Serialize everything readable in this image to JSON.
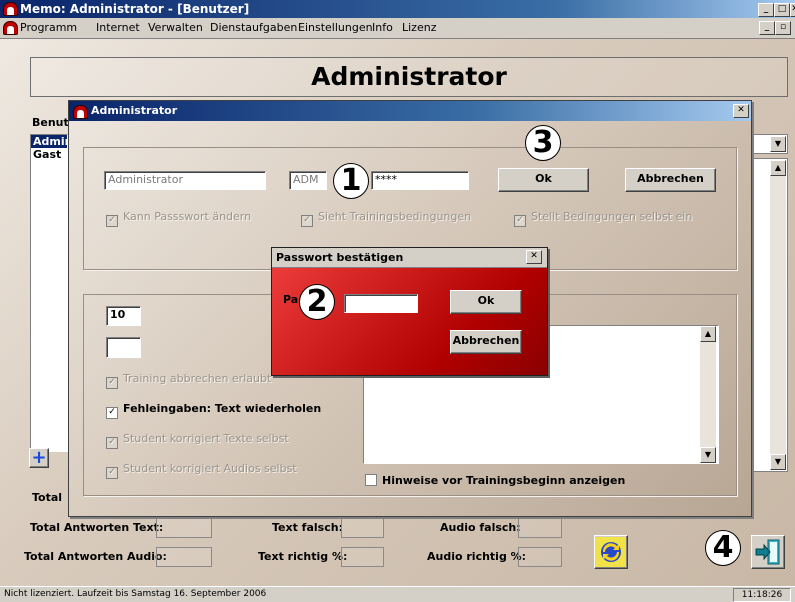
{
  "window": {
    "title": "Memo: Administrator - [Benutzer]"
  },
  "menu": [
    "Programm",
    "Internet",
    "Verwalten",
    "Dienstaufgaben",
    "Einstellungen",
    "Info",
    "Lizenz"
  ],
  "main": {
    "heading": "Administrator",
    "users_label": "Benutzer",
    "users": [
      "Administrator",
      "Gast"
    ],
    "total_label": "Total"
  },
  "dialog": {
    "title": "Administrator",
    "name_value": "Administrator",
    "short_value": "ADM",
    "password_value": "****",
    "ok_label": "Ok",
    "cancel_label": "Abbrechen",
    "check_password": "Kann Passswort ändern",
    "check_conditions_view": "Sieht Trainingsbedingungen",
    "check_conditions_set": "Stellt Bedingungen selbst ein",
    "number_value": "10",
    "check_abort": "Training abbrechen erlaubt",
    "check_repeat": "Fehleingaben: Text wiederholen",
    "check_texts": "Student korrigiert Texte selbst",
    "check_audios": "Student korrigiert Audios selbst",
    "check_hints": "Hinweise vor Trainingsbeginn anzeigen"
  },
  "password_dialog": {
    "title": "Passwort bestätigen",
    "label": "Pa",
    "ok_label": "Ok",
    "cancel_label": "Abbrechen"
  },
  "stats": {
    "total_text": "Total Antworten Text:",
    "total_audio": "Total Antworten Audio:",
    "text_wrong": "Text falsch:",
    "text_right": "Text richtig %:",
    "audio_wrong": "Audio falsch:",
    "audio_right": "Audio richtig %:"
  },
  "callouts": [
    "1",
    "2",
    "3",
    "4"
  ],
  "status": {
    "license": "Nicht lizenziert. Laufzeit bis Samstag 16. September 2006",
    "time": "11:18:26"
  },
  "icons": {
    "app": "headphones-icon",
    "add": "plus-icon",
    "refresh": "refresh-icon",
    "exit": "exit-door-icon"
  }
}
